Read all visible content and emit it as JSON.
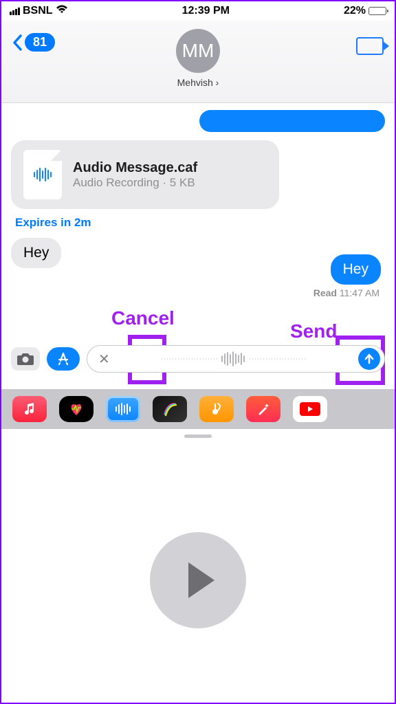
{
  "status_bar": {
    "carrier": "BSNL",
    "time": "12:39 PM",
    "battery_percent": "22%"
  },
  "header": {
    "back_count": "81",
    "avatar_initials": "MM",
    "contact_name": "Mehvish"
  },
  "chat": {
    "file_name": "Audio Message.caf",
    "file_meta": "Audio Recording · 5 KB",
    "expires": "Expires in 2m",
    "received_msg": "Hey",
    "sent_msg": "Hey",
    "read_label": "Read",
    "read_time": "11:47 AM"
  },
  "annotations": {
    "cancel": "Cancel",
    "send": "Send",
    "play": "Play"
  }
}
